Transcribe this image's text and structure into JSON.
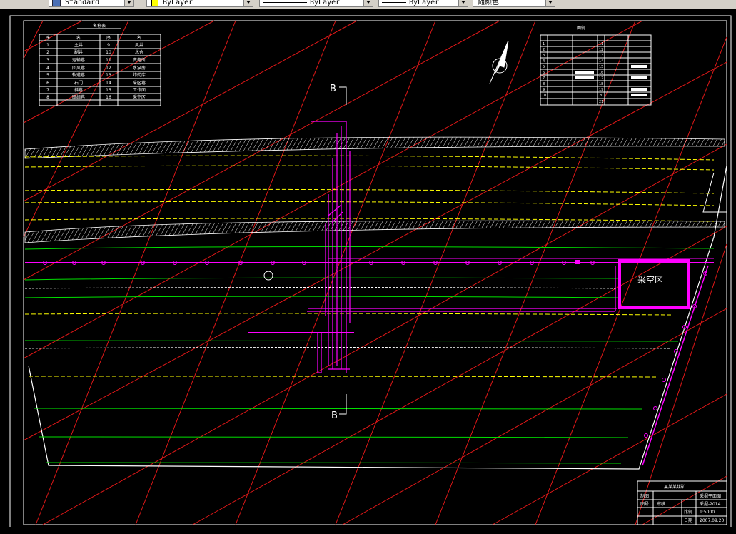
{
  "toolbar": {
    "style_value": "Standard",
    "layer_value": "ByLayer",
    "linetype_value": "ByLayer",
    "lineweight_value": "ByLayer",
    "color_value": "随颜色",
    "layer_swatch_color": "#ffff00"
  },
  "drawing": {
    "section_label_top": "B",
    "section_label_bottom": "B",
    "zone_label": "采空区",
    "zone_color": "#ff00ff",
    "well_color": "#ff00ff",
    "grid_color": "#ff2020",
    "coal_line_color": "#ffff00",
    "strata_line_color": "#00ff00",
    "border_color": "#ffffff"
  },
  "left_table": {
    "title": "名称表",
    "header": [
      "序",
      "名",
      "序",
      "名"
    ],
    "rows": [
      [
        "1",
        "主井",
        "9",
        "风井"
      ],
      [
        "2",
        "副井",
        "10",
        "水仓"
      ],
      [
        "3",
        "运输巷",
        "11",
        "变电所"
      ],
      [
        "4",
        "回风巷",
        "12",
        "水泵房"
      ],
      [
        "5",
        "轨道巷",
        "13",
        "炸药库"
      ],
      [
        "6",
        "石门",
        "14",
        "采区巷"
      ],
      [
        "7",
        "斜巷",
        "15",
        "工作面"
      ],
      [
        "8",
        "联络巷",
        "16",
        "采空区"
      ]
    ]
  },
  "legend_table": {
    "title": "图例",
    "rows": [
      "1",
      "2",
      "3",
      "4",
      "5",
      "6",
      "7",
      "8",
      "9",
      "10"
    ],
    "rows_right": [
      "11",
      "12",
      "13",
      "14",
      "15",
      "16",
      "17",
      "18",
      "19",
      "20",
      "21"
    ]
  },
  "title_block": {
    "company": "某某某煤矿",
    "drawing_name": "采掘平面图",
    "label_drawn": "制图",
    "label_check": "审核",
    "label_scale": "比例",
    "label_date": "日期",
    "label_no": "图号",
    "value_no": "采掘-2014",
    "value_scale": "1:5000",
    "value_date": "2007.09.20"
  }
}
